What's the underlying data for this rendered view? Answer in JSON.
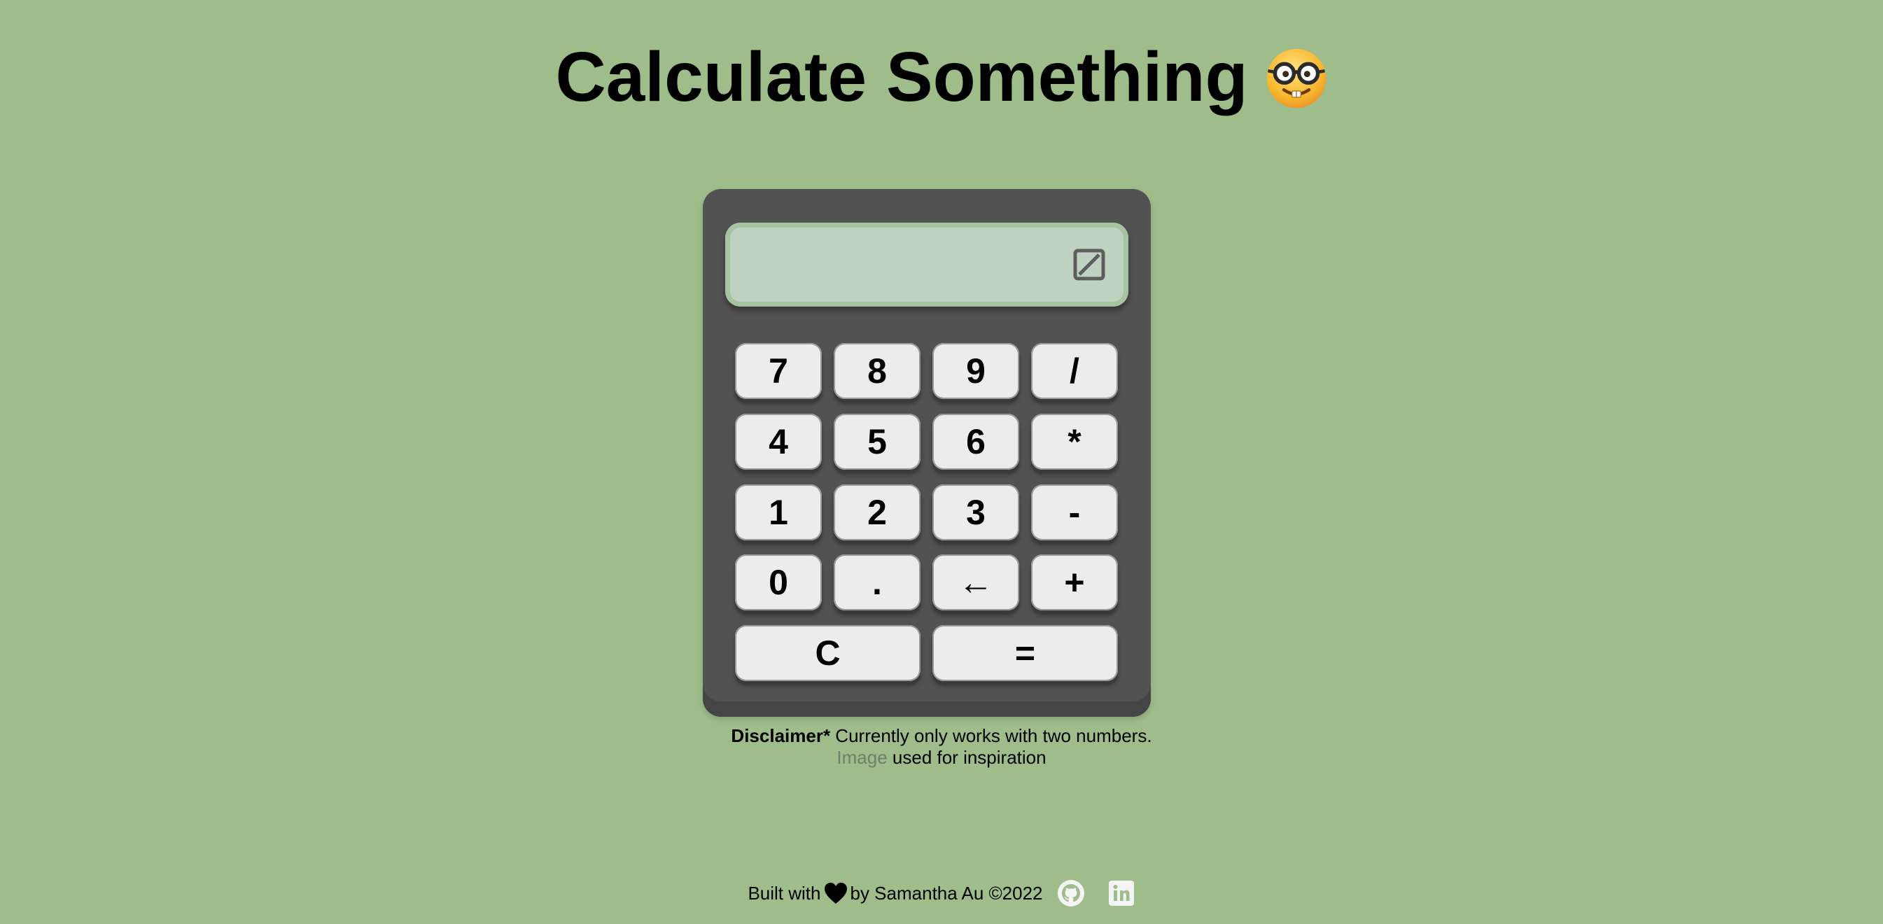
{
  "header": {
    "title": "Calculate Something",
    "emoji_icon": "nerd-face-icon"
  },
  "calculator": {
    "display_value": "",
    "display_icon": "no-entry-square-icon",
    "buttons": [
      {
        "label": "7",
        "name": "seven"
      },
      {
        "label": "8",
        "name": "eight"
      },
      {
        "label": "9",
        "name": "nine"
      },
      {
        "label": "/",
        "name": "divide"
      },
      {
        "label": "4",
        "name": "four"
      },
      {
        "label": "5",
        "name": "five"
      },
      {
        "label": "6",
        "name": "six"
      },
      {
        "label": "*",
        "name": "multiply"
      },
      {
        "label": "1",
        "name": "one"
      },
      {
        "label": "2",
        "name": "two"
      },
      {
        "label": "3",
        "name": "three"
      },
      {
        "label": "-",
        "name": "subtract"
      },
      {
        "label": "0",
        "name": "zero"
      },
      {
        "label": ".",
        "name": "decimal"
      },
      {
        "label": "←",
        "name": "backspace"
      },
      {
        "label": "+",
        "name": "add"
      },
      {
        "label": "C",
        "name": "clear"
      },
      {
        "label": "=",
        "name": "equals"
      }
    ]
  },
  "disclaimer": {
    "bold": "Disclaimer*",
    "text": " Currently only works with two numbers.",
    "link": "Image",
    "after_link": " used for inspiration"
  },
  "footer": {
    "built_with": "Built with",
    "author": "by Samantha Au ©2022",
    "icons": [
      "heart-icon",
      "github-icon",
      "linkedin-icon"
    ]
  },
  "colors": {
    "background": "#9fbd8b",
    "calculator_body": "#525252",
    "screen": "#bfd2c2",
    "button": "#ececec"
  }
}
